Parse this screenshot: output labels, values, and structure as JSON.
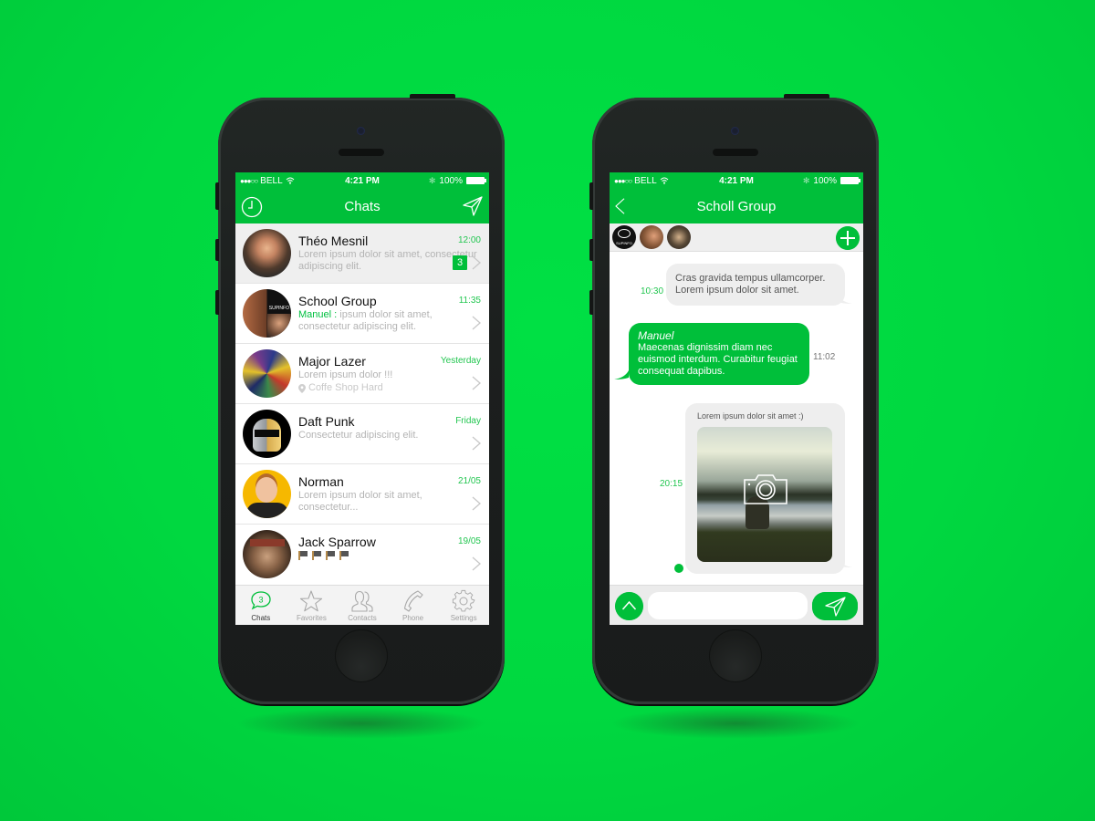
{
  "status_bar": {
    "carrier": "BELL",
    "time": "4:21 PM",
    "battery": "100%",
    "signal_bars_filled": 3,
    "signal_bars_total": 5
  },
  "chats_screen": {
    "title": "Chats",
    "left_icon": "clock-icon",
    "right_icon": "send-icon",
    "items": [
      {
        "name": "Théo Mesnil",
        "time": "12:00",
        "message": "Lorem ipsum dolor sit amet, consectetur adipiscing elit.",
        "badge": "3",
        "selected": true
      },
      {
        "name": "School Group",
        "time": "11:35",
        "sender": "Manuel :",
        "message": " ipsum dolor sit amet, consectetur adipiscing elit."
      },
      {
        "name": "Major Lazer",
        "time": "Yesterday",
        "message": "Lorem ipsum dolor !!!",
        "location": "Coffe Shop Hard"
      },
      {
        "name": "Daft Punk",
        "time": "Friday",
        "message": "Consectetur adipiscing elit."
      },
      {
        "name": "Norman",
        "time": "21/05",
        "message": "Lorem ipsum dolor sit amet, consectetur..."
      },
      {
        "name": "Jack Sparrow",
        "time": "19/05",
        "message": "",
        "flags": 4
      }
    ],
    "tabs": [
      {
        "label": "Chats",
        "icon": "chat-bubble-icon",
        "count": "3",
        "active": true
      },
      {
        "label": "Favorites",
        "icon": "star-icon"
      },
      {
        "label": "Contacts",
        "icon": "contacts-icon"
      },
      {
        "label": "Phone",
        "icon": "phone-icon"
      },
      {
        "label": "Settings",
        "icon": "gear-icon"
      }
    ]
  },
  "group_screen": {
    "title": "Scholl Group",
    "back_icon": "chevron-left-icon",
    "members": [
      "SUPINFO",
      "Member 2",
      "Member 3"
    ],
    "add_member_icon": "plus-icon",
    "messages": [
      {
        "direction": "in",
        "time": "10:30",
        "text": "Cras gravida tempus ullamcorper. Lorem ipsum dolor sit amet."
      },
      {
        "direction": "out",
        "author": "Manuel",
        "time": "11:02",
        "text": "Maecenas dignissim diam nec euismod interdum. Curabitur feugiat consequat dapibus."
      },
      {
        "direction": "in",
        "time": "20:15",
        "text": "Lorem ipsum dolor sit amet :)",
        "attachment": "photo"
      }
    ],
    "compose": {
      "placeholder": "",
      "value": ""
    }
  },
  "colors": {
    "accent": "#00bf3a",
    "background": "#00dc42",
    "time_text": "#22c650",
    "muted_text": "#b4b4b4"
  }
}
